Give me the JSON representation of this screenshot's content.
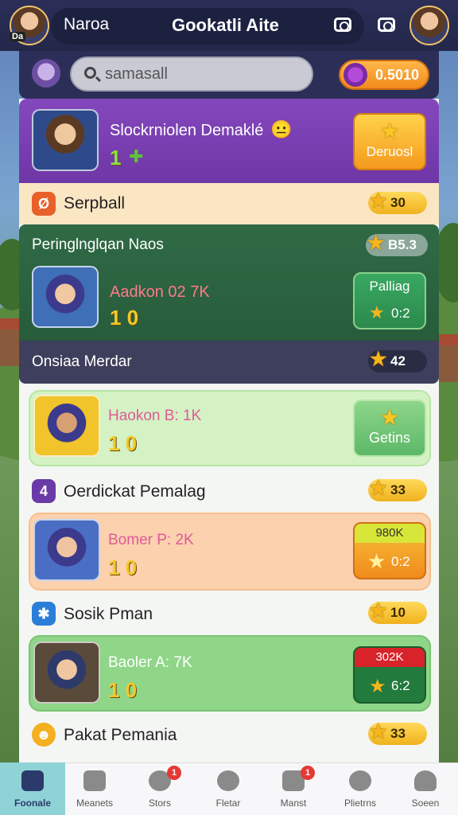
{
  "header": {
    "left_title": "Naroa",
    "title": "Gookatli Aite",
    "avatar_tag": "Da"
  },
  "search": {
    "placeholder": "samasall",
    "currency_value": "0.5010"
  },
  "featured": {
    "title": "Slockrniolen Demaklé",
    "emoji": "😐",
    "level": "1",
    "button_label": "Deruosl"
  },
  "sections": [
    {
      "label": "Serpball",
      "icon_text": "Ø",
      "stars": "30"
    },
    {
      "label": "Onsiaa Merdar",
      "stars": "42"
    },
    {
      "label": "Oerdickat Pemalag",
      "icon_text": "4",
      "stars": "33"
    },
    {
      "label": "Sosik Pman",
      "icon_text": "✱",
      "stars": "10"
    },
    {
      "label": "Pakat Pemania",
      "icon_text": "☻",
      "stars": "33"
    }
  ],
  "green_section": {
    "heading": "Peringlnglqan Naos",
    "heading_badge": "B5.3",
    "game_title": "Aadkon 02 7K",
    "level": "1 0",
    "button_top": "Palliag",
    "button_bottom": "0:2"
  },
  "games": [
    {
      "title": "Haokon B: 1K",
      "level": "1 0",
      "button_label": "Getins"
    },
    {
      "title": "Bomer P: 2K",
      "level": "1 0",
      "button_top": "980K",
      "button_bottom": "0:2"
    },
    {
      "title": "Baoler A: 7K",
      "level": "1 0",
      "button_top": "302K",
      "button_bottom": "6:2"
    }
  ],
  "nav": [
    {
      "label": "Foonale",
      "active": true
    },
    {
      "label": "Meanets"
    },
    {
      "label": "Stors",
      "badge": "1"
    },
    {
      "label": "Fletar"
    },
    {
      "label": "Manst",
      "badge": "1"
    },
    {
      "label": "Plietrns"
    },
    {
      "label": "Soeen"
    }
  ],
  "colors": {
    "header_bg": "#2b2f58",
    "featured_bg": "#7b3fb0",
    "green_section_bg": "#2f6a45",
    "accent_orange": "#f28a1c",
    "star": "#f6b51a"
  }
}
